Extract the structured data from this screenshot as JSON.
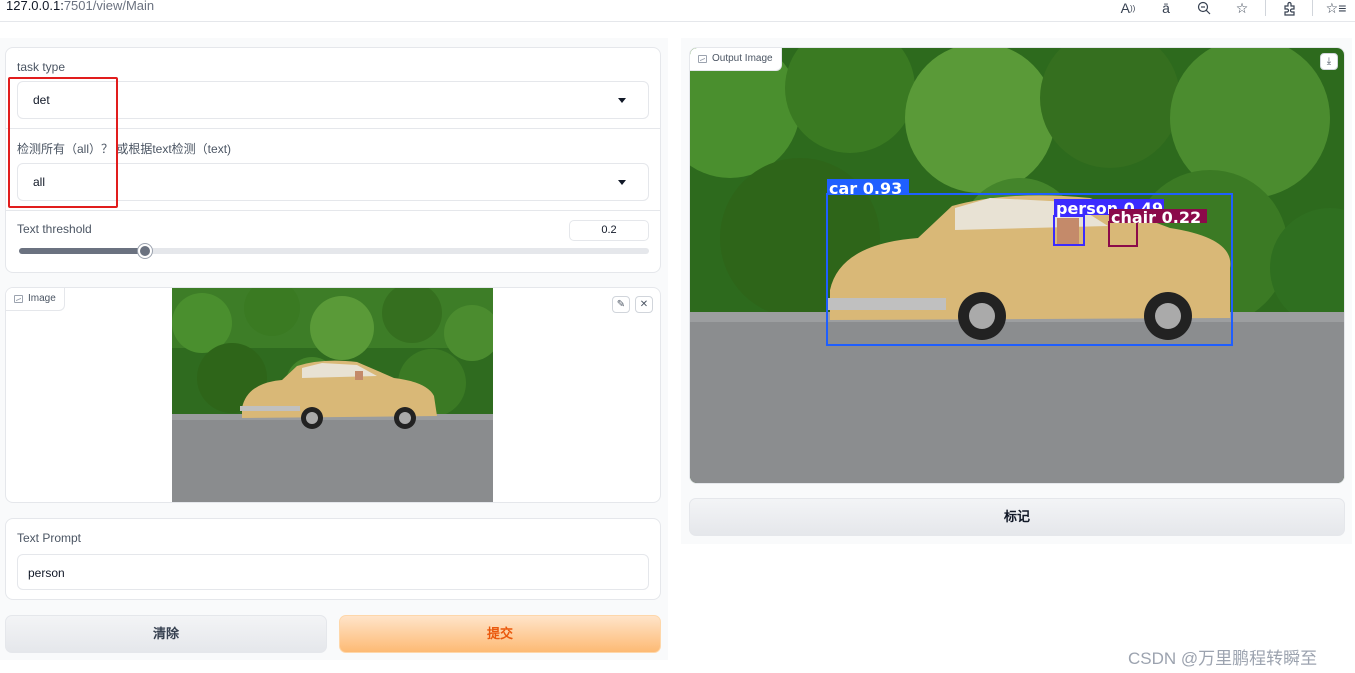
{
  "browser": {
    "url_host": "127.0.0.1:",
    "url_path": "7501/view/Main",
    "icons": [
      "read-aloud-icon",
      "translate-icon",
      "zoom-out-icon",
      "favorite-star-icon",
      "extensions-icon",
      "favorites-list-icon"
    ]
  },
  "settings": {
    "task_type": {
      "label": "task type",
      "value": "det"
    },
    "detect_mode": {
      "label": "检测所有（all）？ 或根据text检测（text)",
      "value": "all"
    },
    "text_threshold": {
      "label": "Text threshold",
      "value": "0.2",
      "fraction": 0.2
    }
  },
  "image_input": {
    "label": "Image"
  },
  "text_prompt": {
    "label": "Text Prompt",
    "value": "person"
  },
  "buttons": {
    "clear": "清除",
    "submit": "提交",
    "mark": "标记"
  },
  "output": {
    "label": "Output Image",
    "detections": [
      {
        "label": "car 0.93",
        "color": "#1f5fff"
      },
      {
        "label": "person 0.49",
        "color": "#3b2bff"
      },
      {
        "label": "chair 0.22",
        "color": "#8b0a4a"
      }
    ]
  },
  "watermark": "CSDN @万里鹏程转瞬至"
}
